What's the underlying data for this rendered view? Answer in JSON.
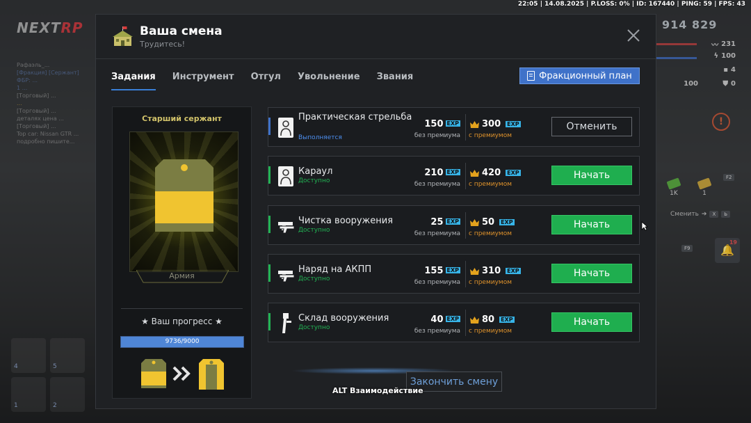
{
  "topbar": {
    "status_text": "22:05 | 14.08.2025 | P.LOSS: 0% | ID: 167440 | PING: 59 | FPS: 43"
  },
  "background": {
    "logo_prefix": "NEXT",
    "logo_suffix": "RP",
    "chat_lines": [
      "Рафаэль_...",
      "[Фракция] [Сержант]",
      "ФБР: ...",
      "1 ...",
      "[Торговый] ...",
      "...",
      "[Торговый] ...",
      "деталях цена ...",
      "[Торговый] ...",
      "Top car: Nissan GTR ...",
      "подробно пишите..."
    ],
    "slots": [
      "4",
      "5",
      "1",
      "2"
    ]
  },
  "hud": {
    "money": "914 829",
    "health": "231",
    "armor": "100",
    "hunger": "4",
    "stat_a": "100",
    "stat_b": "0",
    "alert_icon": "exclamation-icon",
    "cash_a": "1K",
    "cash_b": "1",
    "key_f2": "F2",
    "change_label": "Сменить",
    "key_x": "X",
    "key_y": "Ь",
    "key_f9": "F9",
    "bell_count": "19"
  },
  "modal": {
    "title": "Ваша смена",
    "subtitle": "Трудитесь!",
    "header_icon": "barracks-icon",
    "close_icon": "close-icon",
    "tabs": [
      {
        "label": "Задания",
        "active": true
      },
      {
        "label": "Инструмент",
        "active": false
      },
      {
        "label": "Отгул",
        "active": false
      },
      {
        "label": "Увольнение",
        "active": false
      },
      {
        "label": "Звания",
        "active": false
      }
    ],
    "plan_button": "Фракционный план",
    "plan_icon": "document-icon",
    "rank": {
      "name": "Старший сержант",
      "faction": "Армия",
      "progress_label": "★ Ваш прогресс ★",
      "progress_text": "9736/9000",
      "progress_value": 1.0,
      "progress_color": "#4f86d6"
    },
    "labels": {
      "without_premium": "без премиума",
      "with_premium": "с премиумом",
      "exp": "EXP"
    },
    "tasks": [
      {
        "name": "Практическая стрельба",
        "status": "Выполняется",
        "status_color": "#4d8ff0",
        "stripe_color": "#3f72c9",
        "exp": "150",
        "exp_premium": "300",
        "button": "Отменить",
        "button_type": "cancel",
        "icon": "shooting-target-icon",
        "two_line": true
      },
      {
        "name": "Караул",
        "status": "Доступно",
        "status_color": "#22b454",
        "stripe_color": "#22b454",
        "exp": "210",
        "exp_premium": "420",
        "button": "Начать",
        "button_type": "start",
        "icon": "guard-target-icon",
        "two_line": false
      },
      {
        "name": "Чистка вооружения",
        "status": "Доступно",
        "status_color": "#22b454",
        "stripe_color": "#22b454",
        "exp": "25",
        "exp_premium": "50",
        "button": "Начать",
        "button_type": "start",
        "icon": "guns-icon",
        "two_line": false
      },
      {
        "name": "Наряд на АКПП",
        "status": "Доступно",
        "status_color": "#22b454",
        "stripe_color": "#22b454",
        "exp": "155",
        "exp_premium": "310",
        "button": "Начать",
        "button_type": "start",
        "icon": "guns-icon",
        "two_line": false
      },
      {
        "name": "Склад вооружения",
        "status": "Доступно",
        "status_color": "#22b454",
        "stripe_color": "#22b454",
        "exp": "40",
        "exp_premium": "80",
        "button": "Начать",
        "button_type": "start",
        "icon": "rifle-icon",
        "two_line": false
      }
    ],
    "finish_button": "Закончить смену"
  },
  "hint": {
    "alt": "ALT Взаимодействие"
  }
}
